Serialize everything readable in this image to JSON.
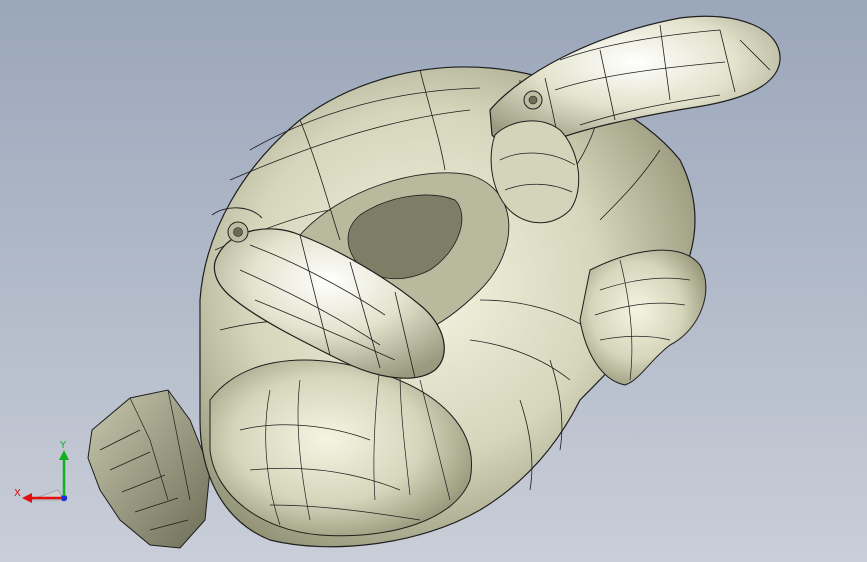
{
  "viewport": {
    "background_top": "#9aa6ba",
    "background_bottom": "#c9ced8"
  },
  "model": {
    "surface_color": "#e6e6cf",
    "edge_color": "#1e1e1e",
    "render_style": "shaded-with-edges"
  },
  "triad": {
    "x_label": "X",
    "y_label": "Y",
    "x_color": "#e01010",
    "y_color": "#10b020",
    "z_color": "#1a2fd8"
  }
}
